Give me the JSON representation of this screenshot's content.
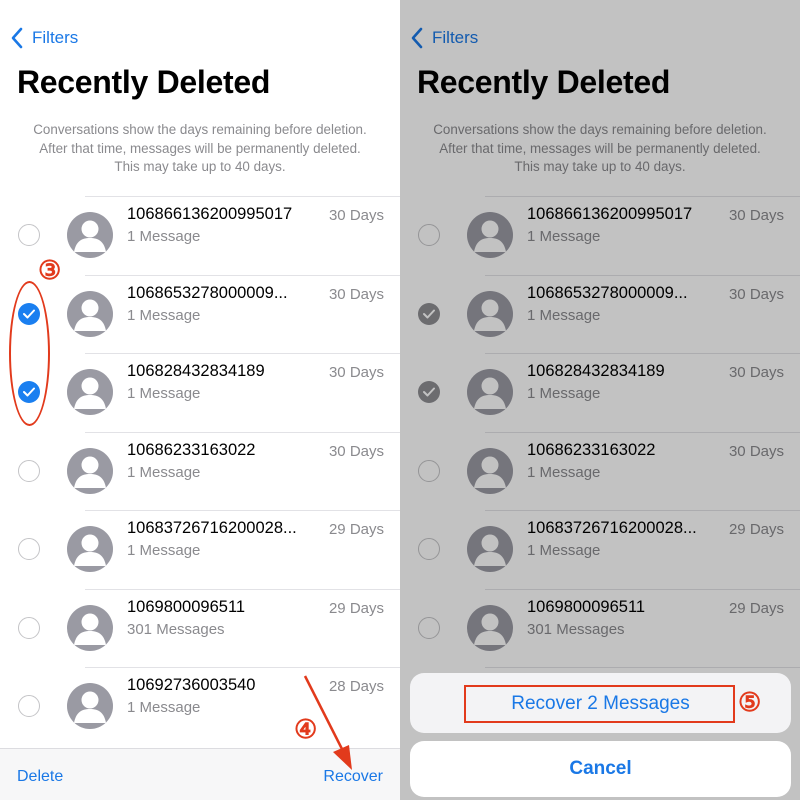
{
  "nav": {
    "back_label": "Filters"
  },
  "page": {
    "title": "Recently Deleted",
    "description_lines": [
      "Conversations show the days remaining before deletion.",
      "After that time, messages will be permanently deleted.",
      "This may take up to 40 days."
    ]
  },
  "conversations": [
    {
      "name": "106866136200995017",
      "count": "1 Message",
      "days": "30 Days",
      "selected": false
    },
    {
      "name": "1068653278000009...",
      "count": "1 Message",
      "days": "30 Days",
      "selected": true
    },
    {
      "name": "106828432834189",
      "count": "1 Message",
      "days": "30 Days",
      "selected": true
    },
    {
      "name": "10686233163022",
      "count": "1 Message",
      "days": "30 Days",
      "selected": false
    },
    {
      "name": "10683726716200028...",
      "count": "1 Message",
      "days": "29 Days",
      "selected": false
    },
    {
      "name": "1069800096511",
      "count": "301 Messages",
      "days": "29 Days",
      "selected": false
    },
    {
      "name": "10692736003540",
      "count": "1 Message",
      "days": "28 Days",
      "selected": false
    }
  ],
  "toolbar": {
    "delete_label": "Delete",
    "recover_label": "Recover"
  },
  "action_sheet": {
    "recover_label": "Recover 2 Messages",
    "cancel_label": "Cancel"
  },
  "annotations": {
    "step3": "③",
    "step4": "④",
    "step5": "⑤"
  },
  "colors": {
    "accent": "#1a78e6",
    "annotation": "#e23a1c",
    "check_selected": "#1a7ff0",
    "check_dimmed": "#8e8e93"
  },
  "icons": {
    "back": "chevron-left-icon",
    "avatar": "person-silhouette-icon",
    "check": "checkmark-icon"
  }
}
